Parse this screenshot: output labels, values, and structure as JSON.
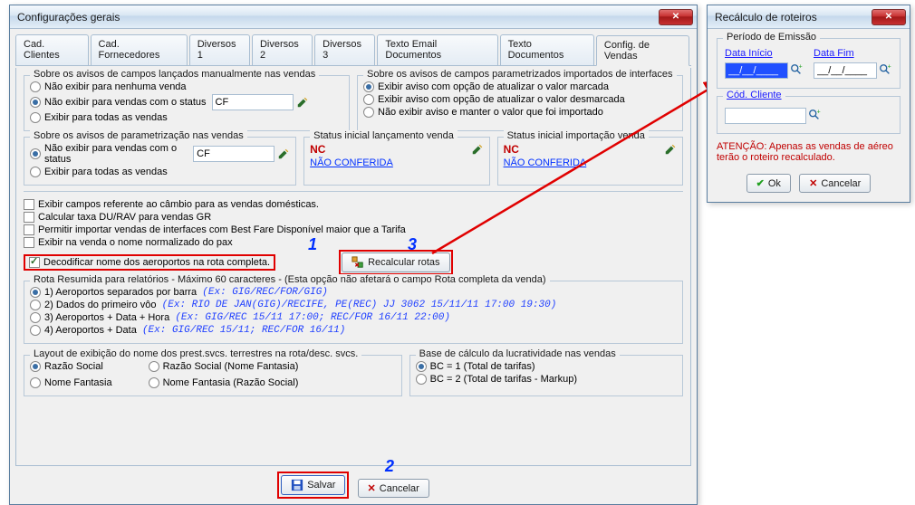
{
  "window_main": {
    "title": "Configurações gerais",
    "tabs": [
      "Cad. Clientes",
      "Cad. Fornecedores",
      "Diversos 1",
      "Diversos 2",
      "Diversos 3",
      "Texto Email Documentos",
      "Texto Documentos",
      "Config. de Vendas"
    ],
    "active_tab": 7,
    "avisos_manuais": {
      "legend": "Sobre os avisos de campos lançados manualmente nas vendas",
      "opt1": "Não exibir para nenhuma venda",
      "opt2": "Não exibir para vendas com o status",
      "opt3": "Exibir para todas as vendas",
      "status_value": "CF"
    },
    "avisos_interfaces": {
      "legend": "Sobre os avisos de campos parametrizados importados de interfaces",
      "opt1": "Exibir aviso com opção de atualizar o valor marcada",
      "opt2": "Exibir aviso com opção de atualizar o valor desmarcada",
      "opt3": "Não exibir aviso e manter o valor que foi importado"
    },
    "avisos_param": {
      "legend": "Sobre os avisos de parametrização nas vendas",
      "opt1": "Não exibir para vendas com o status",
      "opt2": "Exibir para todas as vendas",
      "status_value": "CF"
    },
    "status_lanc": {
      "legend": "Status inicial lançamento venda",
      "code": "NC",
      "desc": "NÃO CONFERIDA"
    },
    "status_imp": {
      "legend": "Status inicial importação venda",
      "code": "NC",
      "desc": "NÃO CONFERIDA"
    },
    "checks": {
      "c1": "Exibir campos referente ao câmbio para as vendas domésticas.",
      "c2": "Calcular taxa DU/RAV para vendas GR",
      "c3": "Permitir importar vendas de interfaces com Best Fare Disponível maior que a Tarifa",
      "c4": "Exibir na venda o nome normalizado do pax",
      "c5": "Decodificar nome dos aeroportos na rota completa."
    },
    "recalc_btn": "Recalcular rotas",
    "rota_panel": {
      "legend": "Rota Resumida para relatórios - Máximo 60 caracteres - (Esta opção não afetará o campo Rota completa da venda)",
      "o1": "1) Aeroportos separados por barra",
      "o1ex": "(Ex: GIG/REC/FOR/GIG)",
      "o2": "2) Dados do primeiro vôo",
      "o2ex": "(Ex: RIO DE JAN(GIG)/RECIFE, PE(REC) JJ 3062 15/11/11 17:00 19:30)",
      "o3": "3) Aeroportos + Data + Hora",
      "o3ex": "(Ex: GIG/REC 15/11 17:00; REC/FOR 16/11 22:00)",
      "o4": "4) Aeroportos + Data",
      "o4ex": "(Ex: GIG/REC 15/11; REC/FOR 16/11)"
    },
    "layout_panel": {
      "legend": "Layout de exibição do nome dos prest.svcs. terrestres na rota/desc. svcs.",
      "o1": "Razão Social",
      "o2": "Nome Fantasia",
      "o3": "Razão Social (Nome Fantasia)",
      "o4": "Nome Fantasia (Razão Social)"
    },
    "base_panel": {
      "legend": "Base de cálculo da lucratividade nas vendas",
      "o1": "BC = 1 (Total de tarifas)",
      "o2": "BC = 2 (Total de tarifas - Markup)"
    },
    "buttons": {
      "save": "Salvar",
      "cancel": "Cancelar"
    }
  },
  "callouts": {
    "n1": "1",
    "n2": "2",
    "n3": "3"
  },
  "window_dlg": {
    "title": "Recálculo de roteiros",
    "periodo_legend": "Período de Emissão",
    "data_inicio_label": "Data Início",
    "data_inicio_value": "__/__/____",
    "data_fim_label": "Data Fim",
    "data_fim_value": "__/__/____",
    "cod_cliente_label": "Cód. Cliente",
    "cod_cliente_value": "",
    "warn": "ATENÇÃO: Apenas as vendas de aéreo terão o roteiro recalculado.",
    "ok": "Ok",
    "cancel": "Cancelar"
  }
}
